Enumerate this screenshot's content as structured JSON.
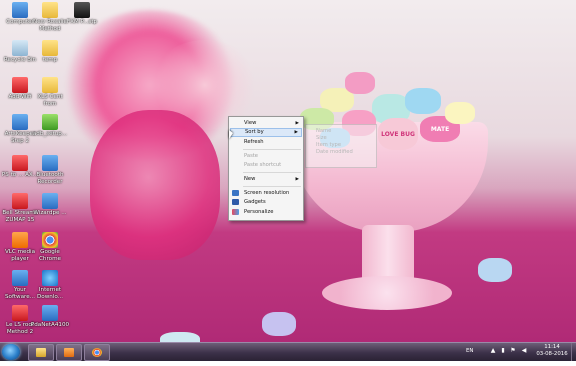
{
  "desktop_icons": [
    {
      "label": "Computer",
      "icon": "computer-icon"
    },
    {
      "label": "New Rosalie Method",
      "icon": "folder-icon"
    },
    {
      "label": "FXM P...stp",
      "icon": "app-icon"
    },
    {
      "label": "Recycle Bin",
      "icon": "recycle-bin-icon"
    },
    {
      "label": "temp",
      "icon": "folder-icon"
    },
    {
      "label": "Add-Wifi",
      "icon": "pdf-icon"
    },
    {
      "label": "XLS Cent from",
      "icon": "folder-icon"
    },
    {
      "label": "ArtsKeeper Step 2",
      "icon": "app-icon"
    },
    {
      "label": "adb_setup...",
      "icon": "android-icon"
    },
    {
      "label": "PS to ... AX...",
      "icon": "app-icon"
    },
    {
      "label": "Bluetooth Recorder",
      "icon": "app-icon"
    },
    {
      "label": "Bell Streams ZUMAP 15",
      "icon": "app-icon"
    },
    {
      "label": "Wizardpe ...",
      "icon": "app-icon"
    },
    {
      "label": "VLC media player",
      "icon": "vlc-icon"
    },
    {
      "label": "Google Chrome",
      "icon": "chrome-icon"
    },
    {
      "label": "Your Software...",
      "icon": "app-icon"
    },
    {
      "label": "Internet Downlo...",
      "icon": "ie-icon"
    },
    {
      "label": "Le LS root Method 2",
      "icon": "pdf-icon"
    },
    {
      "label": "PdaNetA4100",
      "icon": "app-icon"
    }
  ],
  "context_menu": {
    "items": [
      {
        "label": "View",
        "submenu": true,
        "enabled": true
      },
      {
        "label": "Sort by",
        "submenu": true,
        "enabled": true,
        "highlighted": true
      },
      {
        "label": "Refresh",
        "enabled": true
      },
      {
        "label": "Paste",
        "enabled": false
      },
      {
        "label": "Paste shortcut",
        "enabled": false
      },
      {
        "label": "New",
        "submenu": true,
        "enabled": true
      },
      {
        "label": "Screen resolution",
        "enabled": true,
        "icon": "screen-resolution-icon"
      },
      {
        "label": "Gadgets",
        "enabled": true,
        "icon": "gadgets-icon"
      },
      {
        "label": "Personalize",
        "enabled": true,
        "icon": "personalize-icon"
      }
    ]
  },
  "submenu": {
    "items": [
      "Name",
      "Size",
      "Item type",
      "Date modified"
    ]
  },
  "candy_text": {
    "love_bug": "LOVE BUG",
    "mate": "MATE"
  },
  "taskbar": {
    "pinned": [
      "explorer-icon",
      "media-player-icon",
      "chrome-icon"
    ],
    "language": "EN",
    "time": "11:14",
    "date": "03-08-2016"
  },
  "colors": {
    "taskbar": "#3c3149",
    "menu_highlight": "#dbe8f8",
    "accent_pink": "#c23a82"
  }
}
